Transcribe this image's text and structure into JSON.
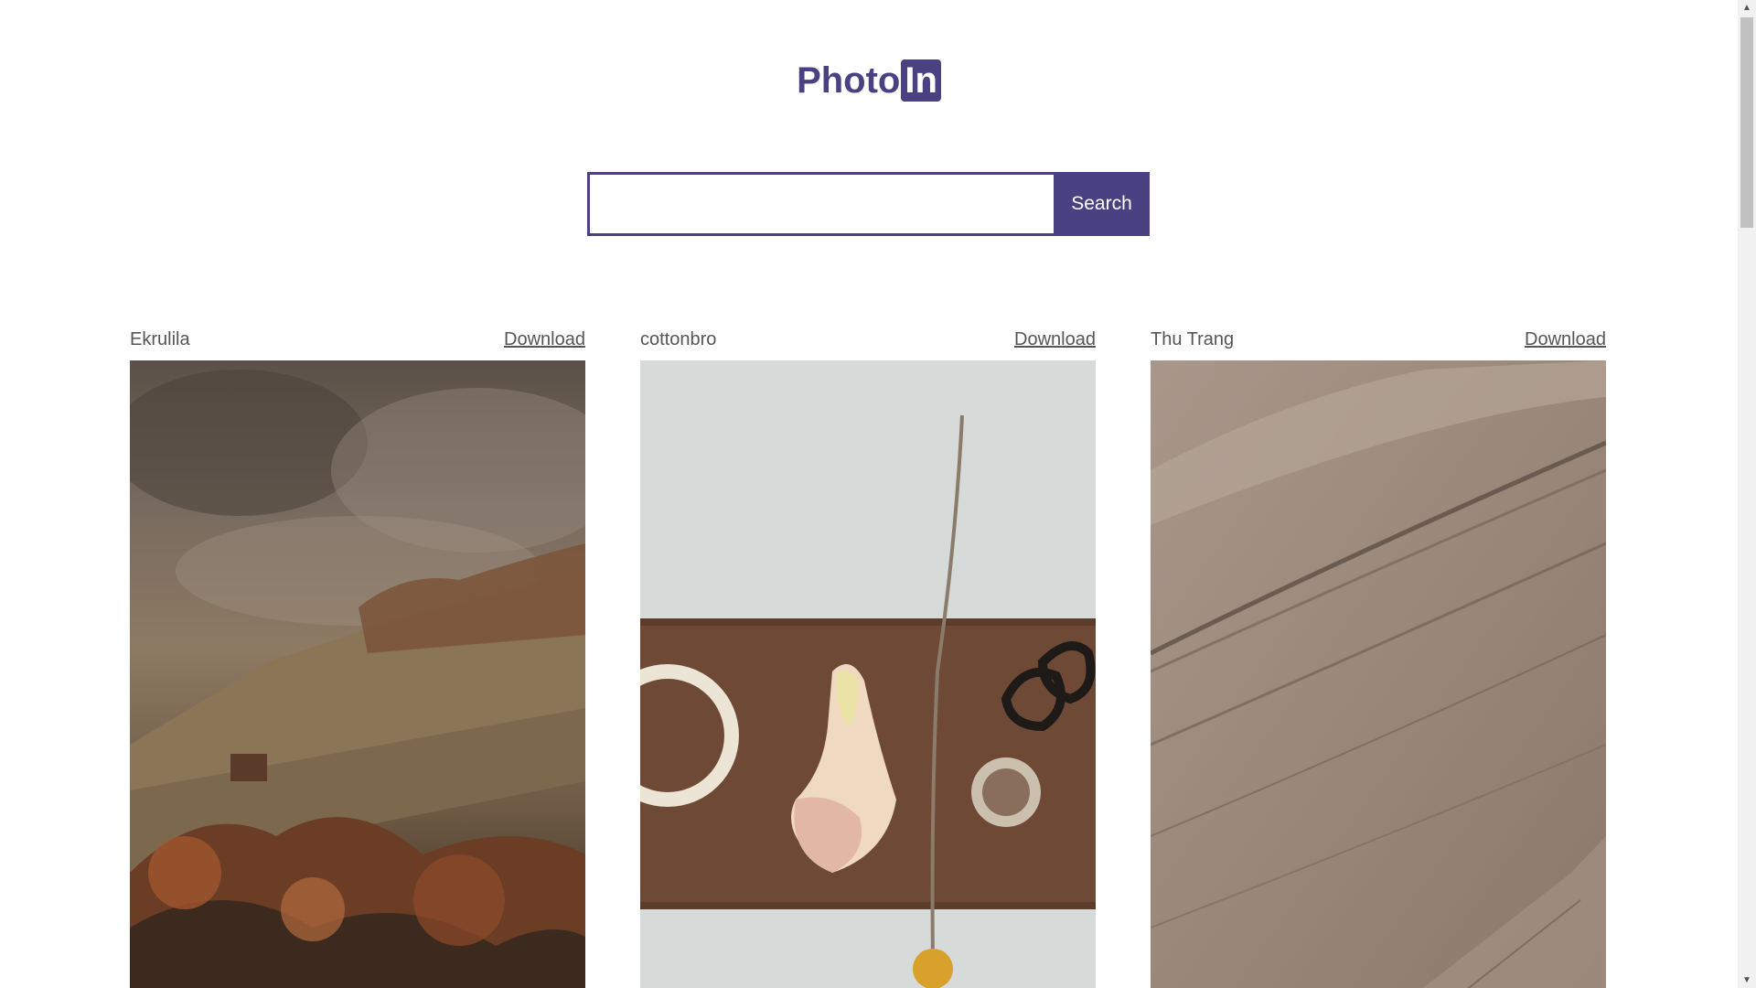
{
  "logo": {
    "text": "Photo",
    "badge": "In",
    "brand_color": "#4a4182"
  },
  "search": {
    "value": "",
    "placeholder": "",
    "button_label": "Search"
  },
  "photos": [
    {
      "author": "Ekrulila",
      "download_label": "Download",
      "subject": "misty autumn hillside forest"
    },
    {
      "author": "cottonbro",
      "download_label": "Download",
      "subject": "calla lily, tape rolls and scissors on wooden board"
    },
    {
      "author": "Thu Trang",
      "download_label": "Download",
      "subject": "sand dune texture"
    }
  ]
}
